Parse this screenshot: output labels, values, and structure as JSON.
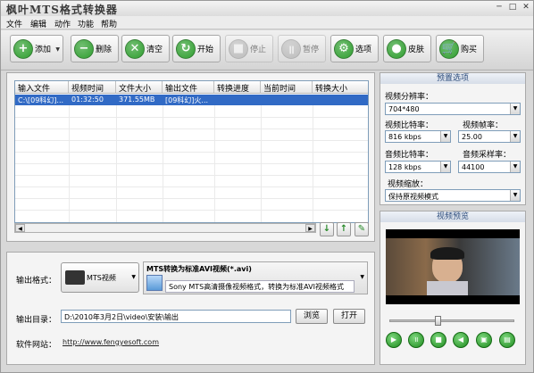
{
  "window": {
    "title": "枫叶MTS格式转换器",
    "minimize": "─",
    "maximize": "□",
    "close": "✕"
  },
  "menu": [
    "文件",
    "编辑",
    "动作",
    "功能",
    "帮助"
  ],
  "toolbar": [
    {
      "label": "添加",
      "icon": "plus-icon",
      "glyph": "+",
      "color": "#2e9e2e"
    },
    {
      "label": "删除",
      "icon": "minus-icon",
      "glyph": "−",
      "color": "#2e9e2e"
    },
    {
      "label": "清空",
      "icon": "clear-icon",
      "glyph": "✕",
      "color": "#2e9e2e"
    },
    {
      "label": "开始",
      "icon": "refresh-icon",
      "glyph": "↻",
      "color": "#2e9e2e"
    },
    {
      "label": "停止",
      "icon": "stop-icon",
      "glyph": "■",
      "color": "#9a9a9a"
    },
    {
      "label": "暂停",
      "icon": "pause-icon",
      "glyph": "॥",
      "color": "#9a9a9a"
    },
    {
      "label": "选项",
      "icon": "options-icon",
      "glyph": "⚙",
      "color": "#2e9e2e"
    },
    {
      "label": "皮肤",
      "icon": "apple-icon",
      "glyph": "●",
      "color": "#2e9e2e"
    },
    {
      "label": "购买",
      "icon": "cart-icon",
      "glyph": "🛒",
      "color": "#2e9e2e"
    }
  ],
  "table": {
    "headers": [
      "输入文件",
      "视频时间",
      "文件大小",
      "输出文件",
      "转换进度",
      "当前时间",
      "转换大小"
    ],
    "rows": [
      [
        "C:\\[09科幻]...",
        "01:32:50",
        "371.55MB",
        "[09科幻]火...",
        "",
        "",
        ""
      ]
    ]
  },
  "bottom": {
    "format_label": "输出格式：",
    "format_device": "MTS视频",
    "format_title": "MTS转换为标准AVI视频(*.avi)",
    "format_desc": "Sony MTS高清摄像视频格式，转换为标准AVI视频格式",
    "output_dir_label": "输出目录：",
    "output_dir": "D:\\2010年3月2日\\video\\安装\\输出",
    "browse": "浏览",
    "open": "打开",
    "website_label": "软件网站：",
    "website": "http://www.fengyesoft.com"
  },
  "preset": {
    "title": "预置选项",
    "resolution_label": "视频分辨率：",
    "resolution": "704*480",
    "vbitrate_label": "视频比特率：",
    "vbitrate": "816 kbps",
    "framerate_label": "视频帧率：",
    "framerate": "25.00",
    "abitrate_label": "音频比特率：",
    "abitrate": "128 kbps",
    "samplerate_label": "音频采样率：",
    "samplerate": "44100",
    "zoom_label": "视频缩放：",
    "zoom": "保持原视频模式"
  },
  "preview": {
    "title": "视频预览",
    "seek_position": 0.38,
    "buttons": [
      "play-icon",
      "pause-icon",
      "stop-icon",
      "rewind-icon",
      "snapshot-icon",
      "folder-icon"
    ],
    "glyphs": [
      "▶",
      "॥",
      "■",
      "◀",
      "▣",
      "▤"
    ]
  },
  "colors": {
    "selection": "#316ac5",
    "green_button": "#2e9e2e",
    "panel_border": "#aaaaaa"
  }
}
